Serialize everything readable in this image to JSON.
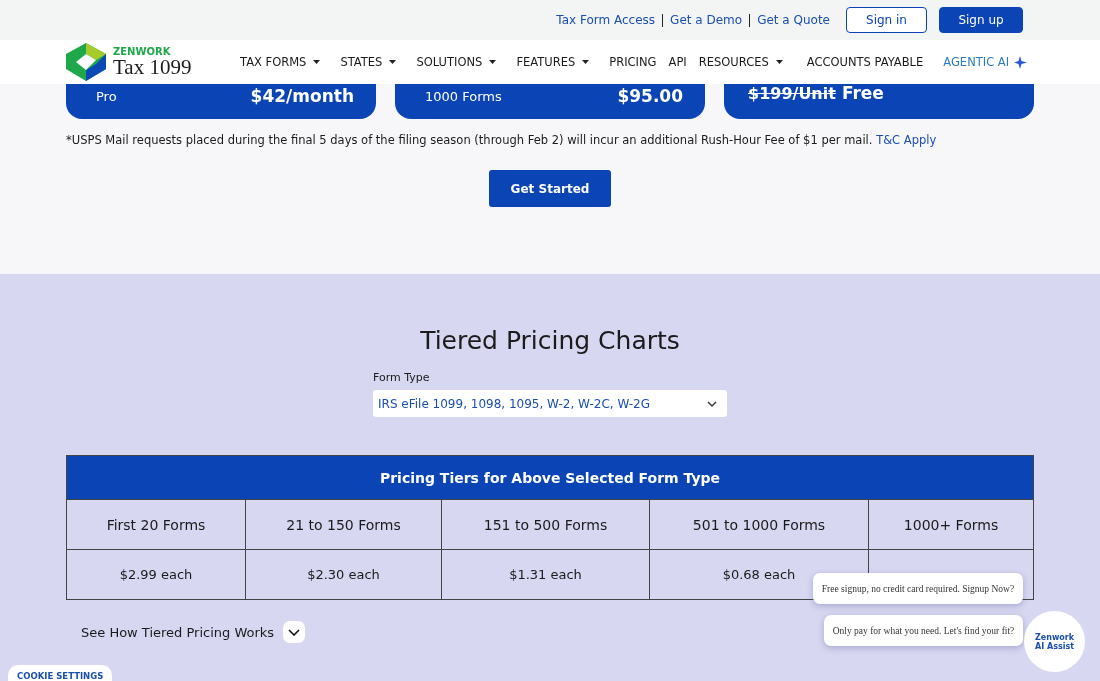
{
  "top_links": [
    "Tax Form Access",
    "Get a Demo",
    "Get a Quote"
  ],
  "top_buttons": [
    {
      "label": "Sign in",
      "kind": "outline"
    },
    {
      "label": "Sign up",
      "kind": "solid"
    }
  ],
  "logo": {
    "brand": "ZENWORK",
    "product": "Tax 1099"
  },
  "nav": [
    {
      "label": "TAX FORMS",
      "dropdown": true,
      "kind": "plain"
    },
    {
      "label": "STATES",
      "dropdown": true,
      "kind": "plain"
    },
    {
      "label": "SOLUTIONS",
      "dropdown": true,
      "kind": "plain"
    },
    {
      "label": "FEATURES",
      "dropdown": true,
      "kind": "plain"
    },
    {
      "label": "PRICING",
      "dropdown": false,
      "kind": "plain"
    },
    {
      "label": "API",
      "dropdown": false,
      "kind": "plain"
    },
    {
      "label": "RESOURCES",
      "dropdown": true,
      "kind": "plain"
    },
    {
      "label": "ACCOUNTS PAYABLE",
      "dropdown": false,
      "kind": "plain"
    },
    {
      "label": "AGENTIC AI",
      "dropdown": false,
      "kind": "ai"
    }
  ],
  "plans": [
    {
      "name": "Pro",
      "price": "$42/month"
    },
    {
      "name": "1000 Forms",
      "price": "$95.00"
    },
    {
      "old_price": "$199/Unit",
      "price": "Free"
    }
  ],
  "note": {
    "text": "*USPS Mail requests placed during the final 5 days of the filing season (through Feb 2) will incur an additional Rush-Hour Fee of $1 per mail.",
    "link": "T&C Apply"
  },
  "cta": "Get Started",
  "tiers": {
    "title": "Tiered Pricing Charts",
    "field_label": "Form Type",
    "field_value": "IRS eFile 1099, 1098, 1095, W-2, W-2C, W-2G",
    "table_title": "Pricing Tiers for Above Selected Form Type",
    "columns": [
      "First 20 Forms",
      "21 to 150 Forms",
      "151 to 500 Forms",
      "501 to 1000 Forms",
      "1000+ Forms"
    ],
    "prices": [
      "$2.99 each",
      "$2.30 each",
      "$1.31 each",
      "$0.68 each"
    ],
    "see_how": "See How Tiered Pricing Works"
  },
  "cookie": "COOKIE SETTINGS",
  "chat": {
    "bubbles": [
      "Free signup, no credit card required. Signup Now?",
      "Only pay for what you need. Let's find your fit?"
    ],
    "brand": "Zenwork",
    "name": "AI Assist"
  }
}
